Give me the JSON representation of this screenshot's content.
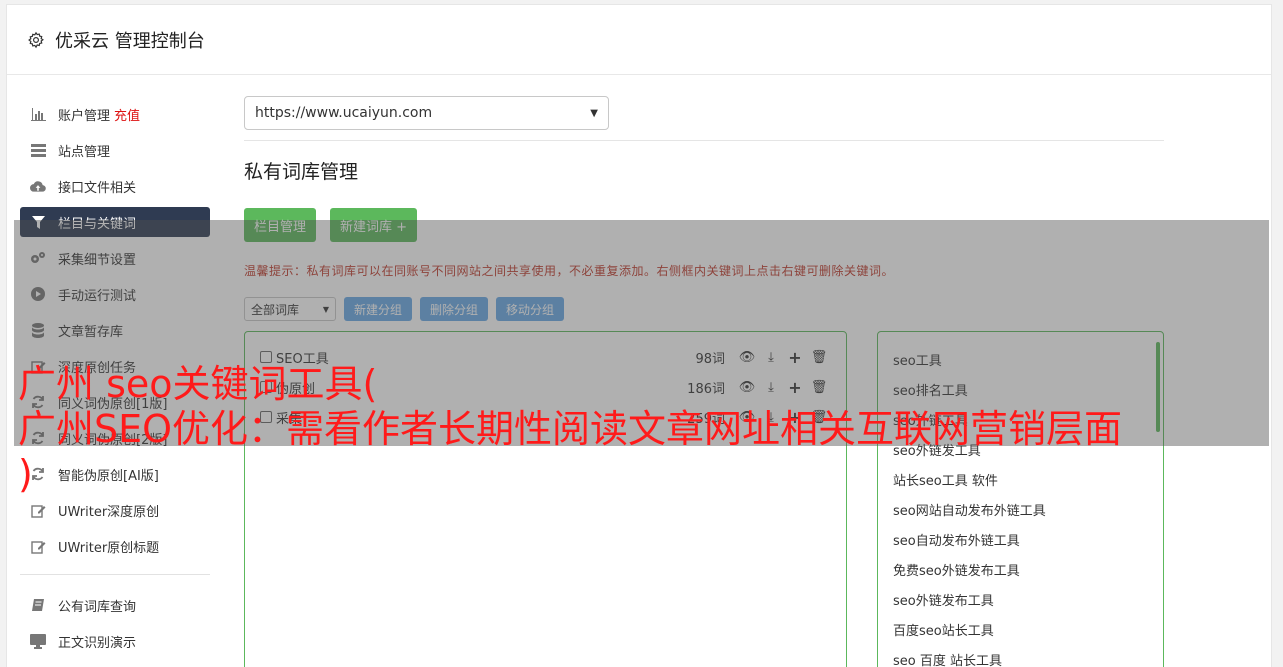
{
  "app": {
    "title": "优采云 管理控制台"
  },
  "sidebar": {
    "items": [
      {
        "icon": "bar-chart-icon",
        "label": "账户管理",
        "extra": "充值"
      },
      {
        "icon": "server-icon",
        "label": "站点管理"
      },
      {
        "icon": "cloud-upload-icon",
        "label": "接口文件相关"
      },
      {
        "icon": "filter-icon",
        "label": "栏目与关键词",
        "active": true
      },
      {
        "icon": "gears-icon",
        "label": "采集细节设置"
      },
      {
        "icon": "play-icon",
        "label": "手动运行测试"
      },
      {
        "icon": "database-icon",
        "label": "文章暂存库"
      },
      {
        "icon": "edit-icon",
        "label": "深度原创任务"
      },
      {
        "icon": "refresh-icon",
        "label": "同义词伪原创[1版]"
      },
      {
        "icon": "refresh-icon",
        "label": "同义词伪原创[2版]"
      },
      {
        "icon": "refresh-icon",
        "label": "智能伪原创[AI版]"
      },
      {
        "icon": "edit-icon",
        "label": "UWriter深度原创"
      },
      {
        "icon": "edit-icon",
        "label": "UWriter原创标题"
      }
    ],
    "items2": [
      {
        "icon": "book-icon",
        "label": "公有词库查询"
      },
      {
        "icon": "monitor-icon",
        "label": "正文识别演示"
      }
    ]
  },
  "main": {
    "site_select": "https://www.ucaiyun.com",
    "section_title": "私有词库管理",
    "btn_columns": "栏目管理",
    "btn_new_lib": "新建词库 +",
    "hint": "温馨提示：私有词库可以在同账号不同网站之间共享使用，不必重复添加。右侧框内关键词上点击右键可删除关键词。",
    "filter_select": "全部词库",
    "btn_new_group": "新建分组",
    "btn_del_group": "删除分组",
    "btn_move_group": "移动分组",
    "libraries": [
      {
        "name": "SEO工具",
        "count": "98词"
      },
      {
        "name": "伪原创",
        "count": "186词"
      },
      {
        "name": "采集",
        "count": "259词"
      }
    ],
    "keywords": [
      "seo工具",
      "seo排名工具",
      "seo外链工具",
      "seo外链发工具",
      "站长seo工具 软件",
      "seo网站自动发布外链工具",
      "seo自动发布外链工具",
      "免费seo外链发布工具",
      "seo外链发布工具",
      "百度seo站长工具",
      "seo 百度 站长工具"
    ]
  },
  "overlay": {
    "headline_line1": "广州 seo关键词工具(",
    "headline_line2": "广州SEO优化：需看作者长期性阅读文章网址相关互联网营销层面",
    "headline_line3": ")"
  }
}
